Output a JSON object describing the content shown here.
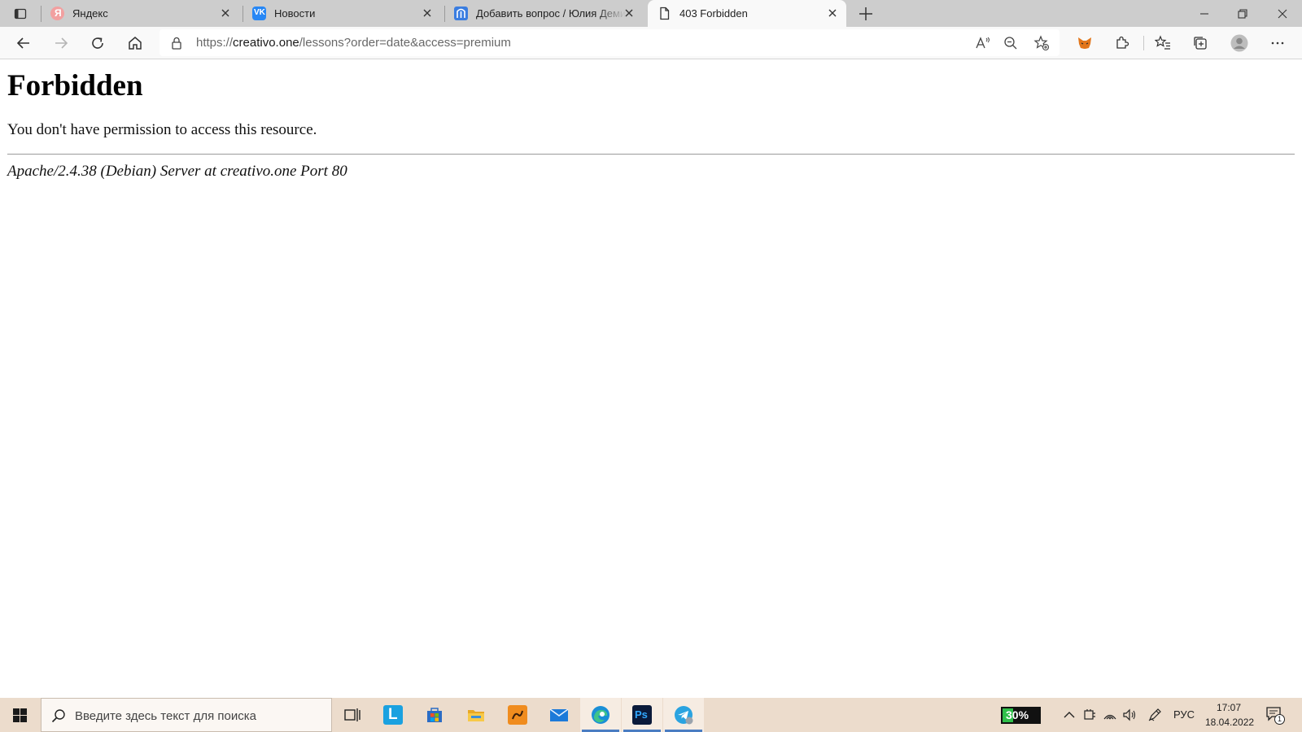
{
  "browser": {
    "tabs": [
      {
        "title": "Яндекс",
        "icon": "yandex-icon",
        "active": false
      },
      {
        "title": "Новости",
        "icon": "vk-icon",
        "active": false
      },
      {
        "title": "Добавить вопрос / Юлия Демина",
        "icon": "question-site-icon",
        "active": false
      },
      {
        "title": "403 Forbidden",
        "icon": "page-icon",
        "active": true
      }
    ],
    "address": {
      "scheme": "https://",
      "domain": "creativo.one",
      "path": "/lessons?order=date&access=premium"
    }
  },
  "page": {
    "heading": "Forbidden",
    "message": "You don't have permission to access this resource.",
    "server_signature": "Apache/2.4.38 (Debian) Server at creativo.one Port 80"
  },
  "taskbar": {
    "search_placeholder": "Введите здесь текст для поиска",
    "apps": [
      {
        "name": "task-view-icon"
      },
      {
        "name": "lingvo-icon"
      },
      {
        "name": "store-icon"
      },
      {
        "name": "file-explorer-icon"
      },
      {
        "name": "drawing-app-icon"
      },
      {
        "name": "mail-icon"
      },
      {
        "name": "edge-icon"
      },
      {
        "name": "photoshop-icon"
      },
      {
        "name": "telegram-icon"
      }
    ],
    "battery_percent": "30%",
    "language": "РУС",
    "time": "17:07",
    "date": "18.04.2022",
    "notification_count": "1"
  },
  "colors": {
    "tab_strip": "#cdcdcd",
    "toolbar": "#f9f9f9",
    "taskbar": "#ecdccc",
    "accent": "#4a7dc2",
    "battery_green": "#2fbf4a"
  }
}
